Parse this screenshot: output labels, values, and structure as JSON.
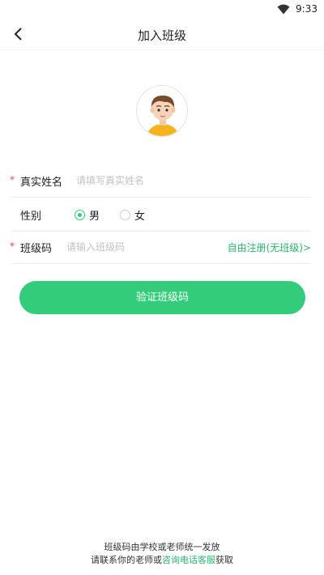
{
  "status": {
    "time": "9:33"
  },
  "nav": {
    "title": "加入班级"
  },
  "form": {
    "name": {
      "required_mark": "*",
      "label": "真实姓名",
      "placeholder": "请填写真实姓名"
    },
    "gender": {
      "label": "性别",
      "options": [
        "男",
        "女"
      ],
      "selected": "男"
    },
    "class_code": {
      "required_mark": "*",
      "label": "班级码",
      "placeholder": "请输入班级码",
      "free_register": "自由注册(无班级)>"
    }
  },
  "verify_button": "验证班级码",
  "footer": {
    "line1": "班级码由学校或老师统一发放",
    "line2_prefix": "请联系你的老师或",
    "line2_link": "咨询电话客服",
    "line2_suffix": "获取"
  },
  "colors": {
    "accent": "#33cc7b",
    "link": "#2fb36f",
    "required": "#e04848"
  },
  "icons": [
    "wifi-icon",
    "back-arrow-icon",
    "avatar-boy-icon"
  ]
}
